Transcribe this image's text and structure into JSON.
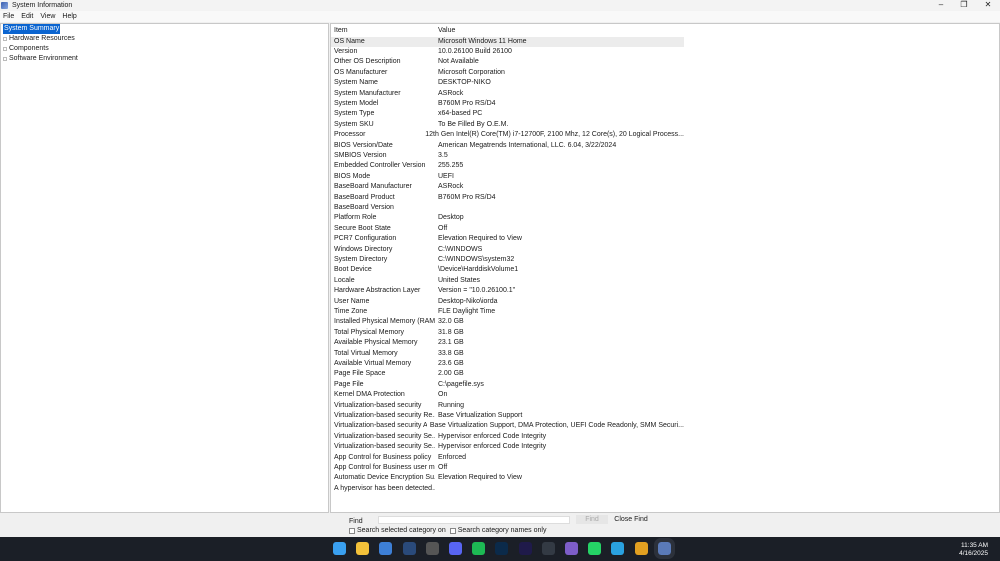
{
  "window": {
    "title": "System Information"
  },
  "menu": [
    "File",
    "Edit",
    "View",
    "Help"
  ],
  "tree": [
    {
      "label": "System Summary",
      "selected": true
    },
    {
      "label": "Hardware Resources"
    },
    {
      "label": "Components"
    },
    {
      "label": "Software Environment"
    }
  ],
  "table": {
    "headers": [
      "Item",
      "Value"
    ],
    "rows": [
      [
        "OS Name",
        "Microsoft Windows 11 Home"
      ],
      [
        "Version",
        "10.0.26100 Build 26100"
      ],
      [
        "Other OS Description",
        "Not Available"
      ],
      [
        "OS Manufacturer",
        "Microsoft Corporation"
      ],
      [
        "System Name",
        "DESKTOP-NIKO"
      ],
      [
        "System Manufacturer",
        "ASRock"
      ],
      [
        "System Model",
        "B760M Pro RS/D4"
      ],
      [
        "System Type",
        "x64-based PC"
      ],
      [
        "System SKU",
        "To Be Filled By O.E.M."
      ],
      [
        "Processor",
        "12th Gen Intel(R) Core(TM) i7-12700F, 2100 Mhz, 12 Core(s), 20 Logical Process..."
      ],
      [
        "BIOS Version/Date",
        "American Megatrends International, LLC. 6.04, 3/22/2024"
      ],
      [
        "SMBIOS Version",
        "3.5"
      ],
      [
        "Embedded Controller Version",
        "255.255"
      ],
      [
        "BIOS Mode",
        "UEFI"
      ],
      [
        "BaseBoard Manufacturer",
        "ASRock"
      ],
      [
        "BaseBoard Product",
        "B760M Pro RS/D4"
      ],
      [
        "BaseBoard Version",
        ""
      ],
      [
        "Platform Role",
        "Desktop"
      ],
      [
        "Secure Boot State",
        "Off"
      ],
      [
        "PCR7 Configuration",
        "Elevation Required to View"
      ],
      [
        "Windows Directory",
        "C:\\WINDOWS"
      ],
      [
        "System Directory",
        "C:\\WINDOWS\\system32"
      ],
      [
        "Boot Device",
        "\\Device\\HarddiskVolume1"
      ],
      [
        "Locale",
        "United States"
      ],
      [
        "Hardware Abstraction Layer",
        "Version = \"10.0.26100.1\""
      ],
      [
        "User Name",
        "Desktop-Niko\\iorda"
      ],
      [
        "Time Zone",
        "FLE Daylight Time"
      ],
      [
        "Installed Physical Memory (RAM)",
        "32.0 GB"
      ],
      [
        "Total Physical Memory",
        "31.8 GB"
      ],
      [
        "Available Physical Memory",
        "23.1 GB"
      ],
      [
        "Total Virtual Memory",
        "33.8 GB"
      ],
      [
        "Available Virtual Memory",
        "23.6 GB"
      ],
      [
        "Page File Space",
        "2.00 GB"
      ],
      [
        "Page File",
        "C:\\pagefile.sys"
      ],
      [
        "Kernel DMA Protection",
        "On"
      ],
      [
        "Virtualization-based security",
        "Running"
      ],
      [
        "Virtualization-based security Re...",
        "Base Virtualization Support"
      ],
      [
        "Virtualization-based security Av...",
        "Base Virtualization Support, DMA Protection, UEFI Code Readonly, SMM Securi..."
      ],
      [
        "Virtualization-based security Se...",
        "Hypervisor enforced Code Integrity"
      ],
      [
        "Virtualization-based security Se...",
        "Hypervisor enforced Code Integrity"
      ],
      [
        "App Control for Business policy",
        "Enforced"
      ],
      [
        "App Control for Business user m...",
        "Off"
      ],
      [
        "Automatic Device Encryption Su...",
        "Elevation Required to View"
      ],
      [
        "A hypervisor has been detected....",
        ""
      ]
    ]
  },
  "find": {
    "label": "Find",
    "value": "",
    "find_button": "Find",
    "close_button": "Close Find",
    "opt1": "Search selected category on",
    "opt2": "Search category names only"
  },
  "taskbar": {
    "time": "11:35 AM",
    "date": "4/16/2025",
    "apps": [
      {
        "name": "start",
        "color": "#3aa0f0"
      },
      {
        "name": "file-explorer",
        "color": "#f3c13a"
      },
      {
        "name": "photos",
        "color": "#3d7fd6"
      },
      {
        "name": "steam",
        "color": "#2a4a7a"
      },
      {
        "name": "github",
        "color": "#555"
      },
      {
        "name": "discord",
        "color": "#5865f2"
      },
      {
        "name": "spotify",
        "color": "#1db954"
      },
      {
        "name": "lightroom",
        "color": "#0b2a4a"
      },
      {
        "name": "premiere",
        "color": "#1f1a4a"
      },
      {
        "name": "davinci",
        "color": "#333a44"
      },
      {
        "name": "viber",
        "color": "#7d5dc8"
      },
      {
        "name": "whatsapp",
        "color": "#25d366"
      },
      {
        "name": "telegram",
        "color": "#2aa2e0"
      },
      {
        "name": "chrome",
        "color": "#e2a021"
      },
      {
        "name": "system-information",
        "color": "#5a7ab8"
      }
    ]
  }
}
